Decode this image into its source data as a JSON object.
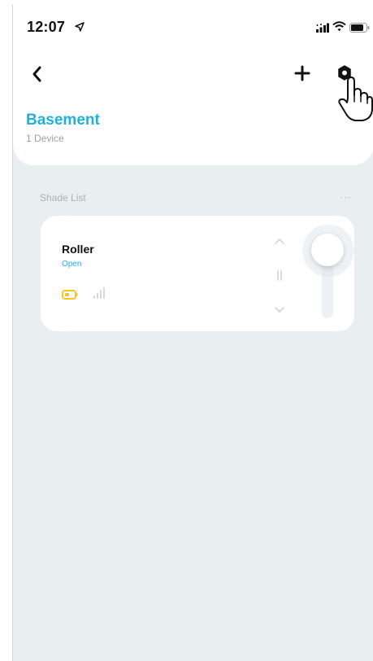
{
  "status_bar": {
    "time": "12:07",
    "icons": [
      "location-arrow-icon",
      "cellular-signal-icon",
      "wifi-icon",
      "battery-icon"
    ]
  },
  "nav": {
    "back_icon": "chevron-left-icon",
    "add_icon": "plus-icon",
    "settings_icon": "hexagon-settings-icon"
  },
  "room": {
    "title": "Basement",
    "device_count": "1 Device"
  },
  "shade_list": {
    "label": "Shade List",
    "more_label": "···",
    "items": [
      {
        "name": "Roller",
        "status": "Open",
        "battery_icon": "battery-low-icon",
        "signal_icon": "signal-bars-icon",
        "position_percent": 100
      }
    ]
  },
  "colors": {
    "accent": "#1fb0de",
    "background": "#e9eef0",
    "battery": "#f5c623",
    "muted": "#a9b1b5"
  }
}
